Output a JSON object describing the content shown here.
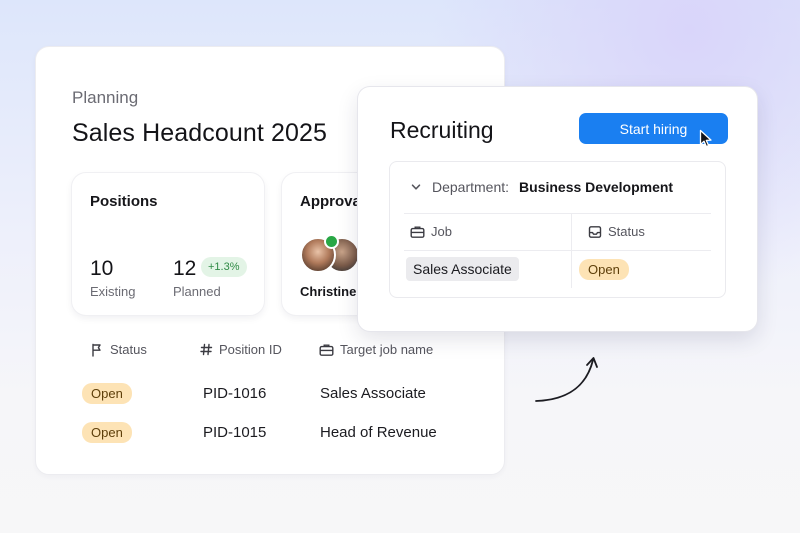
{
  "planning": {
    "eyebrow": "Planning",
    "title": "Sales Headcount 2025",
    "positions": {
      "title": "Positions",
      "existing_value": "10",
      "existing_label": "Existing",
      "planned_value": "12",
      "planned_label": "Planned",
      "delta": "+1.3%"
    },
    "approvals": {
      "title": "Approva",
      "approver_name": "Christine"
    },
    "table": {
      "headers": {
        "status": "Status",
        "position_id": "Position ID",
        "target_job": "Target job name"
      },
      "rows": [
        {
          "status": "Open",
          "position_id": "PID-1016",
          "target_job": "Sales Associate"
        },
        {
          "status": "Open",
          "position_id": "PID-1015",
          "target_job": "Head of Revenue"
        }
      ]
    }
  },
  "recruiting": {
    "title": "Recruiting",
    "start_button": "Start hiring",
    "department_label": "Department:",
    "department_value": "Business Development",
    "columns": {
      "job": "Job",
      "status": "Status"
    },
    "row": {
      "job": "Sales Associate",
      "status": "Open"
    }
  },
  "colors": {
    "accent_blue": "#1a7ff1",
    "open_pill_bg": "#fde3b5",
    "delta_green": "#2f8a45",
    "online_green": "#28a745"
  },
  "icons": {
    "status_header": "flag-icon",
    "position_header": "hash-icon",
    "job_header": "briefcase-icon",
    "dept_toggle": "chevron-down-icon",
    "status_col": "inbox-icon",
    "cursor": "cursor-icon",
    "arrow": "curved-arrow-icon"
  }
}
